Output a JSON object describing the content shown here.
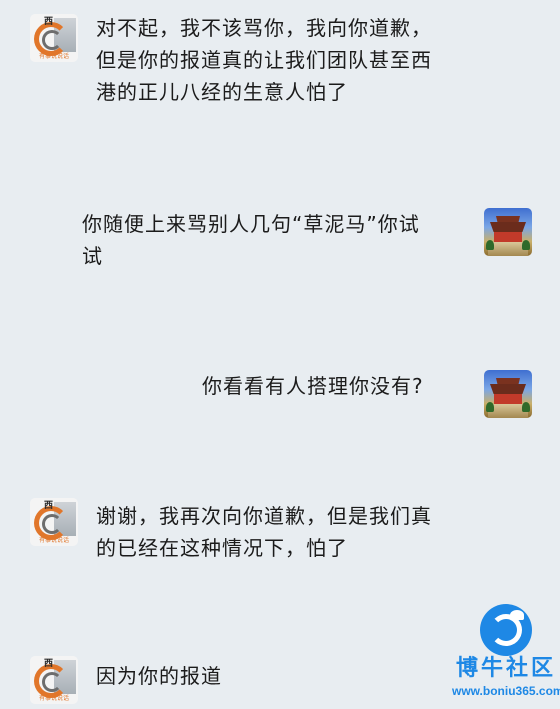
{
  "chat": {
    "messages": [
      {
        "side": "left",
        "avatar": "news-logo-avatar",
        "avatar_text": "西",
        "avatar_caption": "有事说说话",
        "text": "对不起，我不该骂你，我向你道歉，\n但是你的报道真的让我们团队甚至西\n港的正儿八经的生意人怕了"
      },
      {
        "side": "right",
        "avatar": "temple-photo-avatar",
        "text": "你随便上来骂别人几句“草泥马”你试\n试"
      },
      {
        "side": "right",
        "avatar": "temple-photo-avatar",
        "text": "你看看有人搭理你没有?"
      },
      {
        "side": "left",
        "avatar": "news-logo-avatar",
        "avatar_text": "西",
        "avatar_caption": "有事说说话",
        "text": "谢谢，我再次向你道歉，但是我们真\n的已经在这种情况下，怕了"
      },
      {
        "side": "left",
        "avatar": "news-logo-avatar",
        "avatar_text": "西",
        "avatar_caption": "有事说说话",
        "text": "因为你的报道"
      }
    ]
  },
  "watermark": {
    "name": "博牛社区",
    "url": "www.boniu365.com",
    "color": "#1e88e5",
    "icon": "bull-logo-icon"
  }
}
